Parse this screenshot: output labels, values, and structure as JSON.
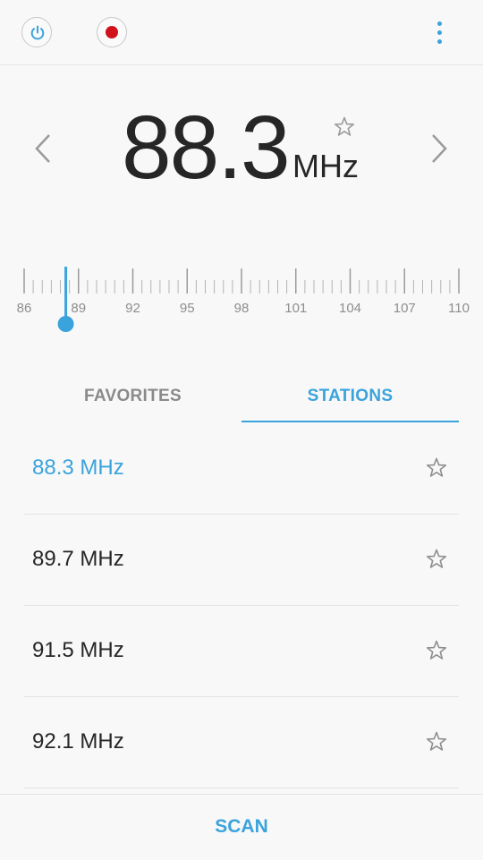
{
  "header": {
    "power_icon": "power-icon",
    "record_icon": "record-icon",
    "more_icon": "more-vertical-icon"
  },
  "tuner": {
    "frequency": "88.3",
    "unit": "MHz",
    "favorite_icon": "star-outline-icon",
    "prev_icon": "chevron-left-icon",
    "next_icon": "chevron-right-icon"
  },
  "dial": {
    "min": 86,
    "max": 110,
    "value": 88.3,
    "labels": [
      "86",
      "89",
      "92",
      "95",
      "98",
      "101",
      "104",
      "107",
      "110"
    ],
    "accent_color": "#3aa3dc"
  },
  "tabs": {
    "favorites_label": "FAVORITES",
    "stations_label": "STATIONS",
    "selected": "STATIONS"
  },
  "stations": [
    {
      "label": "88.3 MHz",
      "active": true
    },
    {
      "label": "89.7 MHz",
      "active": false
    },
    {
      "label": "91.5 MHz",
      "active": false
    },
    {
      "label": "92.1 MHz",
      "active": false
    }
  ],
  "footer": {
    "scan_label": "SCAN"
  },
  "colors": {
    "accent": "#3aa3dc",
    "record": "#d0121b"
  }
}
